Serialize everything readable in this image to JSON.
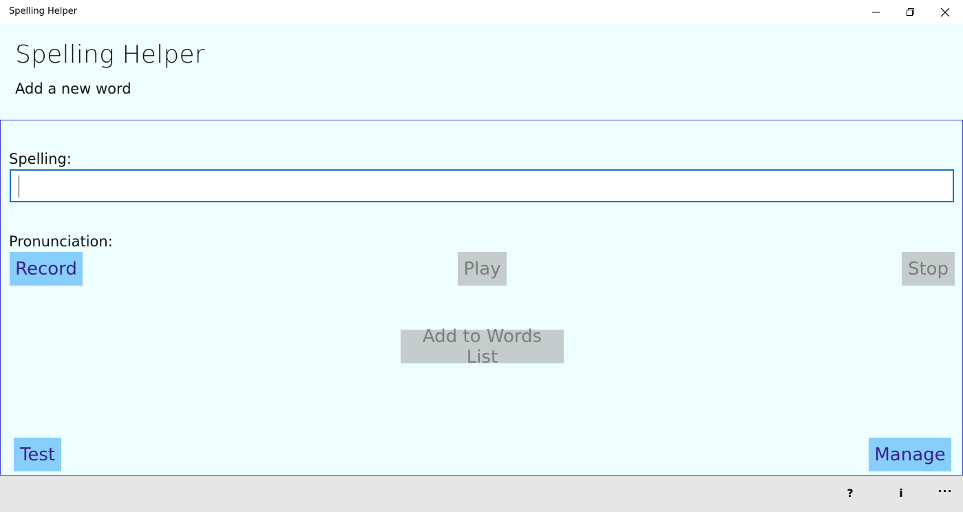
{
  "window": {
    "title": "Spelling Helper"
  },
  "header": {
    "title": "Spelling Helper",
    "subtitle": "Add a new word"
  },
  "form": {
    "spelling_label": "Spelling:",
    "spelling_value": "",
    "pronunciation_label": "Pronunciation:",
    "record_label": "Record",
    "play_label": "Play",
    "stop_label": "Stop",
    "add_label": "Add to Words List"
  },
  "nav": {
    "test_label": "Test",
    "manage_label": "Manage"
  },
  "bottom_bar": {
    "help_glyph": "?",
    "info_glyph": "i",
    "more_glyph": "···"
  },
  "icons": [
    "minimize-icon",
    "restore-icon",
    "close-icon",
    "help-icon",
    "info-icon",
    "more-icon"
  ],
  "colors": {
    "background": "#eefefe",
    "active_button": "#87cefa",
    "active_text": "#3b1f8c",
    "disabled_button": "#c5cccc",
    "disabled_text": "#7d7d7d",
    "accent_border": "#1a73c8"
  }
}
